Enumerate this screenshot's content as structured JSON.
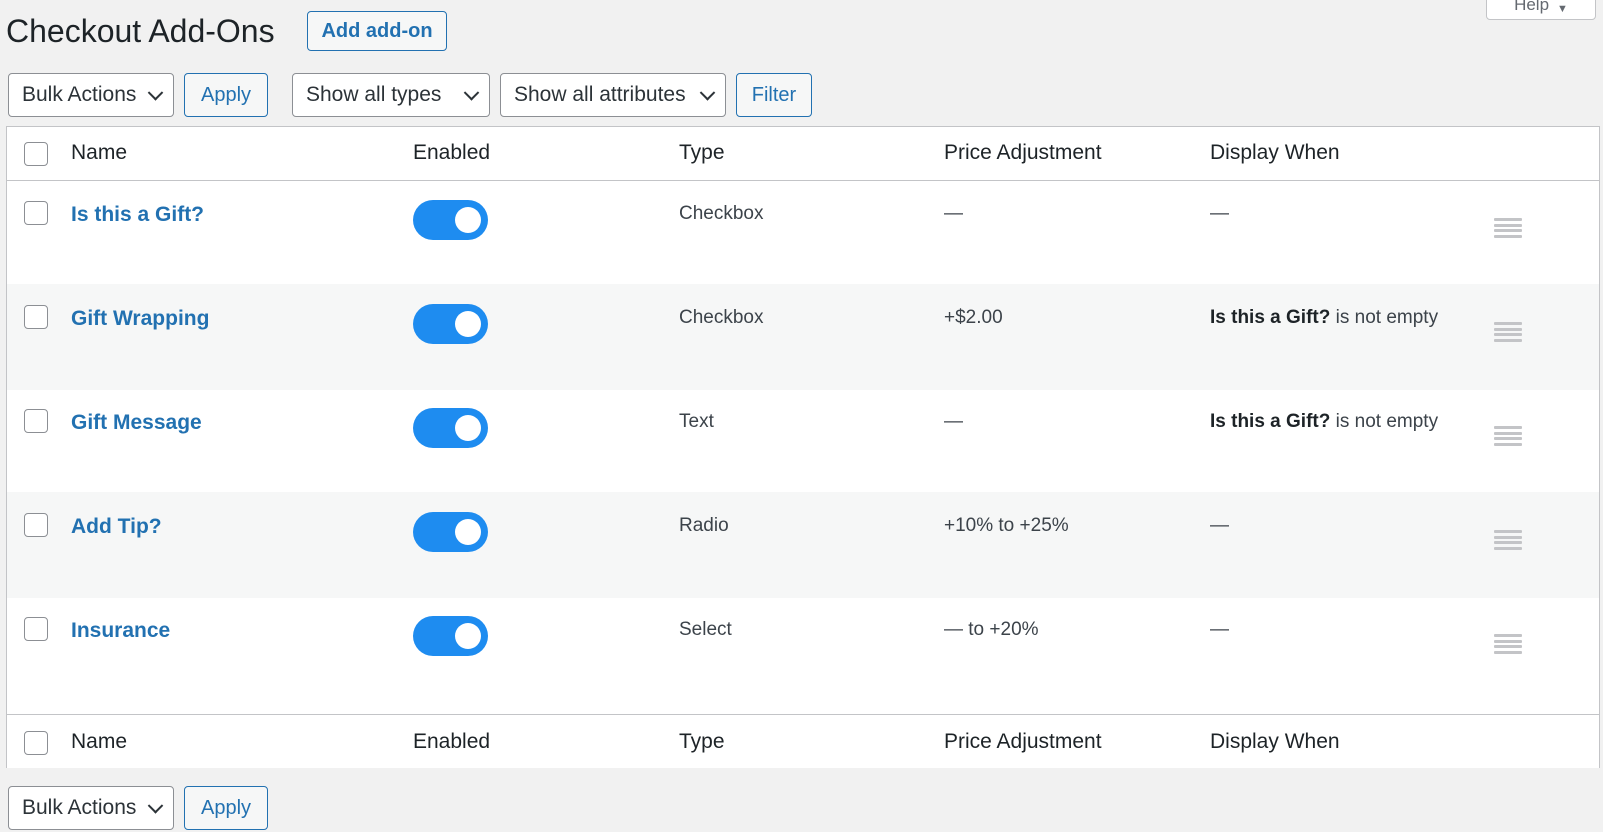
{
  "page": {
    "title": "Checkout Add-Ons",
    "add_button": "Add add-on",
    "help_tab": "Help"
  },
  "toolbar_top": {
    "bulk_actions": "Bulk Actions",
    "apply": "Apply",
    "type_filter": "Show all types",
    "attribute_filter": "Show all attributes",
    "filter": "Filter"
  },
  "columns": {
    "name": "Name",
    "enabled": "Enabled",
    "type": "Type",
    "price": "Price Adjustment",
    "display": "Display When"
  },
  "rows": [
    {
      "name": "Is this a Gift?",
      "enabled": true,
      "type": "Checkbox",
      "price": "—",
      "display_bold": "",
      "display_text": "—"
    },
    {
      "name": "Gift Wrapping",
      "enabled": true,
      "type": "Checkbox",
      "price": "+$2.00",
      "display_bold": "Is this a Gift?",
      "display_text": " is not empty"
    },
    {
      "name": "Gift Message",
      "enabled": true,
      "type": "Text",
      "price": "—",
      "display_bold": "Is this a Gift?",
      "display_text": " is not empty"
    },
    {
      "name": "Add Tip?",
      "enabled": true,
      "type": "Radio",
      "price": "+10% to +25%",
      "display_bold": "",
      "display_text": "—"
    },
    {
      "name": "Insurance",
      "enabled": true,
      "type": "Select",
      "price": "— to +20%",
      "display_bold": "",
      "display_text": "—"
    }
  ],
  "toolbar_bottom": {
    "bulk_actions": "Bulk Actions",
    "apply": "Apply"
  },
  "colors": {
    "link": "#2271b1",
    "toggle_on": "#1e8cf0"
  }
}
